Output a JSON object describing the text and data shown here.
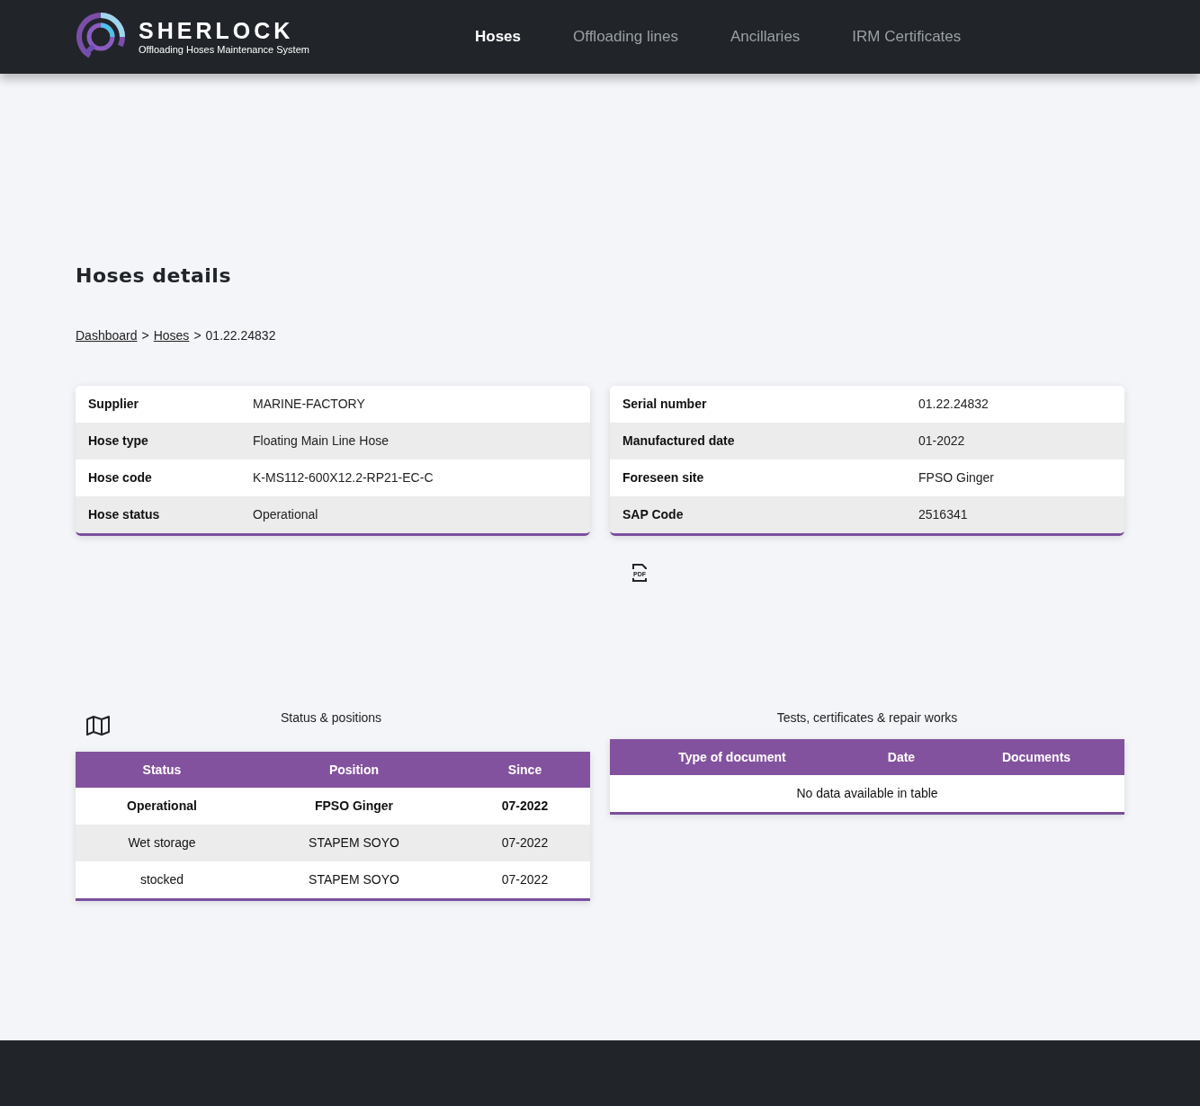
{
  "brand": {
    "name": "SHERLOCK",
    "tagline": "Offloading Hoses Maintenance System"
  },
  "nav": [
    {
      "label": "Hoses",
      "selected": true
    },
    {
      "label": "Offloading lines",
      "selected": false
    },
    {
      "label": "Ancillaries",
      "selected": false
    },
    {
      "label": "IRM Certificates",
      "selected": false
    }
  ],
  "page_title": "Hoses details",
  "breadcrumb": {
    "links": [
      "Dashboard",
      "Hoses"
    ],
    "separator": ">",
    "current": "01.22.24832"
  },
  "details_left": [
    {
      "label": "Supplier",
      "value": "MARINE-FACTORY"
    },
    {
      "label": "Hose type",
      "value": "Floating Main Line Hose"
    },
    {
      "label": "Hose code",
      "value": "K-MS112-600X12.2-RP21-EC-C"
    },
    {
      "label": "Hose status",
      "value": "Operational"
    }
  ],
  "details_right": [
    {
      "label": "Serial number",
      "value": "01.22.24832"
    },
    {
      "label": "Manufactured date",
      "value": "01-2022"
    },
    {
      "label": "Foreseen site",
      "value": "FPSO Ginger"
    },
    {
      "label": "SAP Code",
      "value": "2516341"
    }
  ],
  "pdf_icon_label": "PDF",
  "positions": {
    "title": "Status & positions",
    "columns": [
      "Status",
      "Position",
      "Since"
    ],
    "rows": [
      {
        "cells": [
          "Operational",
          "FPSO Ginger",
          "07-2022"
        ],
        "current": true
      },
      {
        "cells": [
          "Wet storage",
          "STAPEM SOYO",
          "07-2022"
        ],
        "current": false
      },
      {
        "cells": [
          "stocked",
          "STAPEM SOYO",
          "07-2022"
        ],
        "current": false
      }
    ]
  },
  "documents": {
    "title": "Tests, certificates & repair works",
    "columns": [
      "Type of document",
      "Date",
      "Documents"
    ],
    "empty_message": "No data available in table"
  }
}
